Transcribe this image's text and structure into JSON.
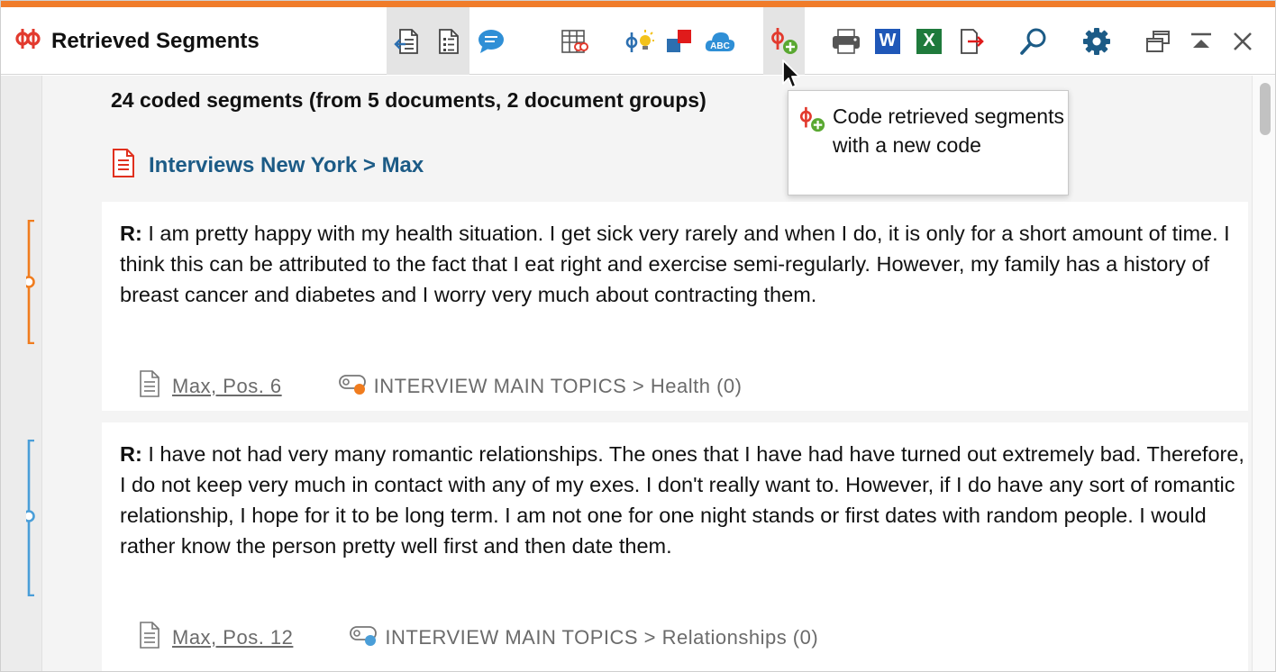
{
  "window": {
    "title": "Retrieved Segments",
    "accent_color": "#f07c2a"
  },
  "toolbar": {
    "buttons": [
      {
        "name": "activate-document-icon",
        "pressed": true
      },
      {
        "name": "list-view-icon",
        "pressed": true
      },
      {
        "name": "comment-icon",
        "pressed": false
      },
      {
        "name": "table-overview-icon",
        "pressed": false
      },
      {
        "name": "code-idea-icon",
        "pressed": false
      },
      {
        "name": "color-squares-icon",
        "pressed": false
      },
      {
        "name": "word-cloud-icon",
        "pressed": false
      },
      {
        "name": "code-new-icon",
        "pressed": true
      },
      {
        "name": "print-icon",
        "pressed": false
      },
      {
        "name": "word-export-icon",
        "pressed": false
      },
      {
        "name": "excel-export-icon",
        "pressed": false
      },
      {
        "name": "export-icon",
        "pressed": false
      },
      {
        "name": "search-icon",
        "pressed": false
      },
      {
        "name": "settings-icon",
        "pressed": false
      },
      {
        "name": "undock-window-icon",
        "pressed": false
      },
      {
        "name": "collapse-icon",
        "pressed": false
      },
      {
        "name": "close-icon",
        "pressed": false
      }
    ],
    "word_label": "W",
    "excel_label": "X"
  },
  "summary": {
    "text": "24 coded segments (from 5 documents, 2 document groups)"
  },
  "document": {
    "heading": "Interviews New York > Max"
  },
  "segments": [
    {
      "speaker": "R:",
      "text": " I am pretty happy with my health situation. I get sick very rarely and when I do, it is only for a short amount of time. I think this can be attributed to the fact that I eat right and exercise semi-regularly. However, my family has a history of breast cancer and diabetes and I worry very much about contracting them.",
      "source": "Max, Pos. 6",
      "code": "INTERVIEW MAIN TOPICS > Health (0)",
      "color": "#f07c1e"
    },
    {
      "speaker": "R:",
      "text": " I have not had very many romantic relationships. The ones that I have had have turned out extremely bad. Therefore, I do not keep very much in contact with any of my exes. I don't really want to. However, if I do have any sort of romantic relationship, I hope for it to be long term. I am not one for one night stands or first dates with random people. I would rather know the person pretty well first and then date them.",
      "source": "Max, Pos. 12",
      "code": "INTERVIEW MAIN TOPICS > Relationships (0)",
      "color": "#4a9ed8"
    }
  ],
  "tooltip": {
    "text": "Code retrieved segments with a new code"
  }
}
